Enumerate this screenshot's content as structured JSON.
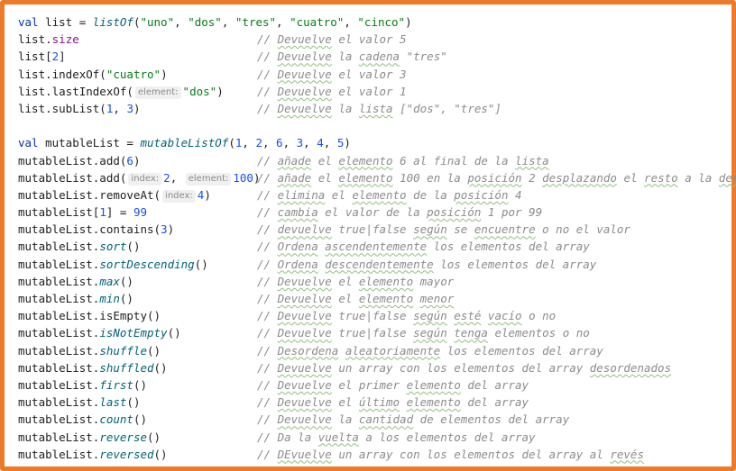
{
  "theme": {
    "border_color": "#ec7a2a",
    "keyword_color": "#0033b3",
    "string_color": "#067d17",
    "number_color": "#1750eb",
    "comment_color": "#8c8c8c",
    "property_color": "#871094",
    "function_color": "#00627a"
  },
  "lines": [
    {
      "code": [
        {
          "t": "val",
          "k": "kw"
        },
        {
          "t": " list = "
        },
        {
          "t": "listOf",
          "k": "fn"
        },
        {
          "t": "("
        },
        {
          "t": "\"uno\"",
          "k": "str"
        },
        {
          "t": ", "
        },
        {
          "t": "\"dos\"",
          "k": "str"
        },
        {
          "t": ", "
        },
        {
          "t": "\"tres\"",
          "k": "str"
        },
        {
          "t": ", "
        },
        {
          "t": "\"cuatro\"",
          "k": "str"
        },
        {
          "t": ", "
        },
        {
          "t": "\"cinco\"",
          "k": "str"
        },
        {
          "t": ")"
        }
      ],
      "comment": []
    },
    {
      "code": [
        {
          "t": "list."
        },
        {
          "t": "size",
          "k": "prop"
        }
      ],
      "comment": [
        {
          "t": "// "
        },
        {
          "t": "Devuelve",
          "sp": true
        },
        {
          "t": " el valor 5"
        }
      ]
    },
    {
      "code": [
        {
          "t": "list["
        },
        {
          "t": "2",
          "k": "num"
        },
        {
          "t": "]"
        }
      ],
      "comment": [
        {
          "t": "// "
        },
        {
          "t": "Devuelve",
          "sp": true
        },
        {
          "t": " la "
        },
        {
          "t": "cadena",
          "sp": true
        },
        {
          "t": " \"tres\""
        }
      ]
    },
    {
      "code": [
        {
          "t": "list.indexOf("
        },
        {
          "t": "\"cuatro\"",
          "k": "str"
        },
        {
          "t": ")"
        }
      ],
      "comment": [
        {
          "t": "// "
        },
        {
          "t": "Devuelve",
          "sp": true
        },
        {
          "t": " el valor 3"
        }
      ]
    },
    {
      "code": [
        {
          "t": "list.lastIndexOf("
        },
        {
          "h": "element:"
        },
        {
          "t": "\"dos\"",
          "k": "str"
        },
        {
          "t": ")"
        }
      ],
      "comment": [
        {
          "t": "// "
        },
        {
          "t": "Devuelve",
          "sp": true
        },
        {
          "t": " el valor 1"
        }
      ]
    },
    {
      "code": [
        {
          "t": "list.subList("
        },
        {
          "t": "1",
          "k": "num"
        },
        {
          "t": ", "
        },
        {
          "t": "3",
          "k": "num"
        },
        {
          "t": ")"
        }
      ],
      "comment": [
        {
          "t": "// "
        },
        {
          "t": "Devuelve",
          "sp": true
        },
        {
          "t": " la "
        },
        {
          "t": "lista",
          "sp": true
        },
        {
          "t": " [\"dos\", \"tres\"]"
        }
      ]
    },
    {
      "code": [],
      "comment": []
    },
    {
      "code": [
        {
          "t": "val",
          "k": "kw"
        },
        {
          "t": " mutableList = "
        },
        {
          "t": "mutableListOf",
          "k": "fn"
        },
        {
          "t": "("
        },
        {
          "t": "1",
          "k": "num"
        },
        {
          "t": ", "
        },
        {
          "t": "2",
          "k": "num"
        },
        {
          "t": ", "
        },
        {
          "t": "6",
          "k": "num"
        },
        {
          "t": ", "
        },
        {
          "t": "3",
          "k": "num"
        },
        {
          "t": ", "
        },
        {
          "t": "4",
          "k": "num"
        },
        {
          "t": ", "
        },
        {
          "t": "5",
          "k": "num"
        },
        {
          "t": ")"
        }
      ],
      "comment": []
    },
    {
      "code": [
        {
          "t": "mutableList.add("
        },
        {
          "t": "6",
          "k": "num"
        },
        {
          "t": ")"
        }
      ],
      "comment": [
        {
          "t": "// "
        },
        {
          "t": "añade",
          "sp": true
        },
        {
          "t": " el "
        },
        {
          "t": "elemento",
          "sp": true
        },
        {
          "t": " 6 al final de la "
        },
        {
          "t": "lista",
          "sp": true
        }
      ]
    },
    {
      "code": [
        {
          "t": "mutableList.add("
        },
        {
          "h": "index:"
        },
        {
          "t": "2",
          "k": "num"
        },
        {
          "t": ", "
        },
        {
          "h": "element:"
        },
        {
          "t": "100",
          "k": "num"
        },
        {
          "t": ")"
        }
      ],
      "comment": [
        {
          "t": "// "
        },
        {
          "t": "añade",
          "sp": true
        },
        {
          "t": " el "
        },
        {
          "t": "elemento",
          "sp": true
        },
        {
          "t": " 100 en la "
        },
        {
          "t": "posición",
          "sp": true
        },
        {
          "t": " 2 "
        },
        {
          "t": "desplazando",
          "sp": true
        },
        {
          "t": " el "
        },
        {
          "t": "resto",
          "sp": true
        },
        {
          "t": " a la "
        },
        {
          "t": "derecha",
          "sp": true
        }
      ]
    },
    {
      "code": [
        {
          "t": "mutableList.removeAt("
        },
        {
          "h": "index:"
        },
        {
          "t": "4",
          "k": "num"
        },
        {
          "t": ")"
        }
      ],
      "comment": [
        {
          "t": "// "
        },
        {
          "t": "elimina",
          "sp": true
        },
        {
          "t": " el "
        },
        {
          "t": "elemento",
          "sp": true
        },
        {
          "t": " de la "
        },
        {
          "t": "posición",
          "sp": true
        },
        {
          "t": " 4"
        }
      ]
    },
    {
      "code": [
        {
          "t": "mutableList["
        },
        {
          "t": "1",
          "k": "num"
        },
        {
          "t": "] = "
        },
        {
          "t": "99",
          "k": "num"
        }
      ],
      "comment": [
        {
          "t": "// "
        },
        {
          "t": "cambia",
          "sp": true
        },
        {
          "t": " el valor de la "
        },
        {
          "t": "posición",
          "sp": true
        },
        {
          "t": " 1 por 99"
        }
      ]
    },
    {
      "code": [
        {
          "t": "mutableList.contains("
        },
        {
          "t": "3",
          "k": "num"
        },
        {
          "t": ")"
        }
      ],
      "comment": [
        {
          "t": "// "
        },
        {
          "t": "devuelve",
          "sp": true
        },
        {
          "t": " true|false "
        },
        {
          "t": "según",
          "sp": true
        },
        {
          "t": " se "
        },
        {
          "t": "encuentre",
          "sp": true
        },
        {
          "t": " o no el valor"
        }
      ]
    },
    {
      "code": [
        {
          "t": "mutableList."
        },
        {
          "t": "sort",
          "k": "fn"
        },
        {
          "t": "()"
        }
      ],
      "comment": [
        {
          "t": "// "
        },
        {
          "t": "Ordena",
          "sp": true
        },
        {
          "t": " "
        },
        {
          "t": "ascendentemente",
          "sp": true
        },
        {
          "t": " los elementos del array"
        }
      ]
    },
    {
      "code": [
        {
          "t": "mutableList."
        },
        {
          "t": "sortDescending",
          "k": "fn"
        },
        {
          "t": "()"
        }
      ],
      "comment": [
        {
          "t": "// "
        },
        {
          "t": "Ordena",
          "sp": true
        },
        {
          "t": " "
        },
        {
          "t": "descendentemente",
          "sp": true
        },
        {
          "t": " los elementos del array"
        }
      ]
    },
    {
      "code": [
        {
          "t": "mutableList."
        },
        {
          "t": "max",
          "k": "fn"
        },
        {
          "t": "()"
        }
      ],
      "comment": [
        {
          "t": "// "
        },
        {
          "t": "Devuelve",
          "sp": true
        },
        {
          "t": " el "
        },
        {
          "t": "elemento",
          "sp": true
        },
        {
          "t": " mayor"
        }
      ]
    },
    {
      "code": [
        {
          "t": "mutableList."
        },
        {
          "t": "min",
          "k": "fn"
        },
        {
          "t": "()"
        }
      ],
      "comment": [
        {
          "t": "// "
        },
        {
          "t": "Devuelve",
          "sp": true
        },
        {
          "t": " el "
        },
        {
          "t": "elemento",
          "sp": true
        },
        {
          "t": " "
        },
        {
          "t": "menor",
          "sp": true
        }
      ]
    },
    {
      "code": [
        {
          "t": "mutableList.isEmpty()"
        }
      ],
      "comment": [
        {
          "t": "// "
        },
        {
          "t": "Devuelve",
          "sp": true
        },
        {
          "t": " true|false "
        },
        {
          "t": "según",
          "sp": true
        },
        {
          "t": " "
        },
        {
          "t": "esté",
          "sp": true
        },
        {
          "t": " "
        },
        {
          "t": "vacío",
          "sp": true
        },
        {
          "t": " o no"
        }
      ]
    },
    {
      "code": [
        {
          "t": "mutableList."
        },
        {
          "t": "isNotEmpty",
          "k": "fn"
        },
        {
          "t": "()"
        }
      ],
      "comment": [
        {
          "t": "// "
        },
        {
          "t": "Devuelve",
          "sp": true
        },
        {
          "t": " true|false "
        },
        {
          "t": "según",
          "sp": true
        },
        {
          "t": " "
        },
        {
          "t": "tenga",
          "sp": true
        },
        {
          "t": " elementos o no"
        }
      ]
    },
    {
      "code": [
        {
          "t": "mutableList."
        },
        {
          "t": "shuffle",
          "k": "fn"
        },
        {
          "t": "()"
        }
      ],
      "comment": [
        {
          "t": "// "
        },
        {
          "t": "Desordena",
          "sp": true
        },
        {
          "t": " "
        },
        {
          "t": "aleatoriamente",
          "sp": true
        },
        {
          "t": " los elementos del array"
        }
      ]
    },
    {
      "code": [
        {
          "t": "mutableList."
        },
        {
          "t": "shuffled",
          "k": "fn"
        },
        {
          "t": "()"
        }
      ],
      "comment": [
        {
          "t": "// "
        },
        {
          "t": "Devuelve",
          "sp": true
        },
        {
          "t": " un array con los elementos del array "
        },
        {
          "t": "desordenados",
          "sp": true
        }
      ]
    },
    {
      "code": [
        {
          "t": "mutableList."
        },
        {
          "t": "first",
          "k": "fn"
        },
        {
          "t": "()"
        }
      ],
      "comment": [
        {
          "t": "// "
        },
        {
          "t": "Devuelve",
          "sp": true
        },
        {
          "t": " el primer "
        },
        {
          "t": "elemento",
          "sp": true
        },
        {
          "t": " del array"
        }
      ]
    },
    {
      "code": [
        {
          "t": "mutableList."
        },
        {
          "t": "last",
          "k": "fn"
        },
        {
          "t": "()"
        }
      ],
      "comment": [
        {
          "t": "// "
        },
        {
          "t": "Devuelve",
          "sp": true
        },
        {
          "t": " el "
        },
        {
          "t": "último",
          "sp": true
        },
        {
          "t": " "
        },
        {
          "t": "elemento",
          "sp": true
        },
        {
          "t": " del array"
        }
      ]
    },
    {
      "code": [
        {
          "t": "mutableList."
        },
        {
          "t": "count",
          "k": "fn"
        },
        {
          "t": "()"
        }
      ],
      "comment": [
        {
          "t": "// "
        },
        {
          "t": "Devuelve",
          "sp": true
        },
        {
          "t": " la "
        },
        {
          "t": "cantidad",
          "sp": true
        },
        {
          "t": " de elementos del array"
        }
      ]
    },
    {
      "code": [
        {
          "t": "mutableList."
        },
        {
          "t": "reverse",
          "k": "fn"
        },
        {
          "t": "()"
        }
      ],
      "comment": [
        {
          "t": "// "
        },
        {
          "t": "Da la "
        },
        {
          "t": "vuelta",
          "sp": true
        },
        {
          "t": " a los elementos del array"
        }
      ]
    },
    {
      "code": [
        {
          "t": "mutableList."
        },
        {
          "t": "reversed",
          "k": "fn"
        },
        {
          "t": "()"
        }
      ],
      "comment": [
        {
          "t": "// "
        },
        {
          "t": "DEvuelve",
          "sp": true
        },
        {
          "t": " un array con los elementos del array al "
        },
        {
          "t": "revés",
          "sp": true
        }
      ]
    }
  ]
}
